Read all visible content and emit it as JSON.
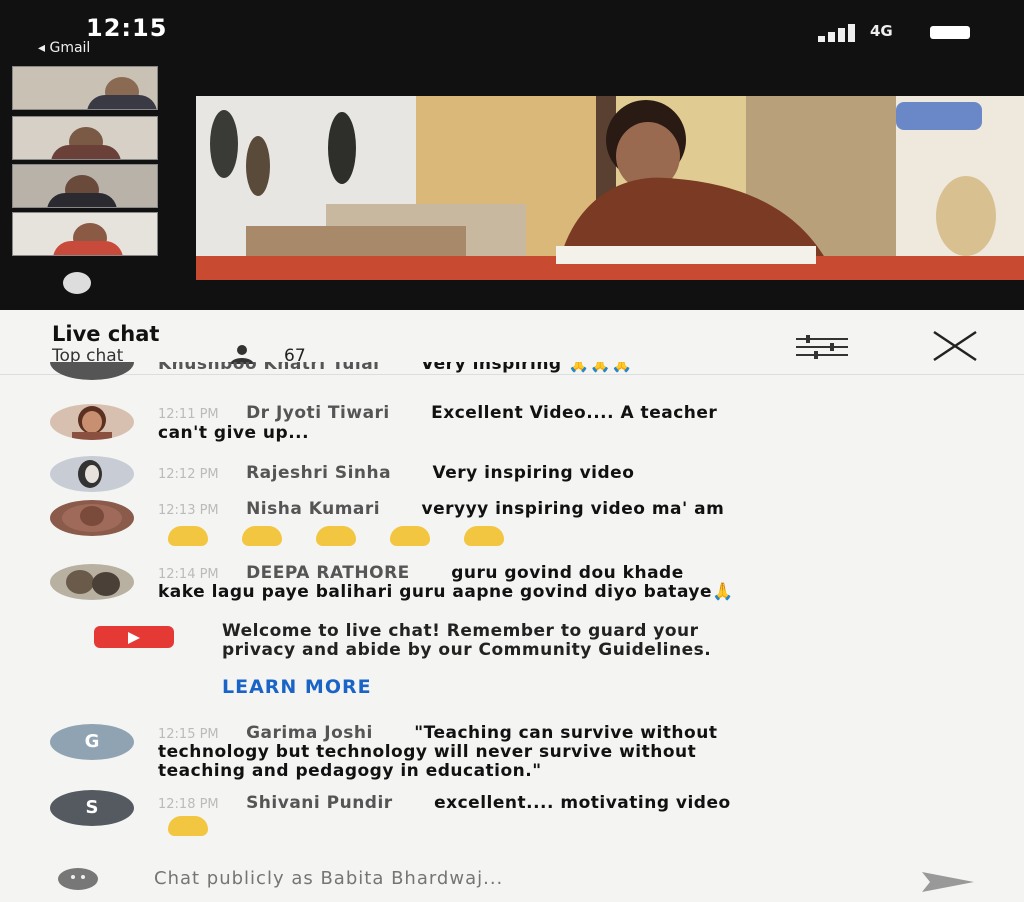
{
  "status_bar": {
    "time": "12:15",
    "back_app": "◂ Gmail",
    "network": "4G"
  },
  "chat": {
    "title": "Live chat",
    "filter_label": "Top chat",
    "viewer_count": "67",
    "partial_message": {
      "author": "Khushboo Khatri Tulai",
      "text": "Very inspiring 🙏🙏🙏"
    },
    "messages": [
      {
        "time": "12:11 PM",
        "author": "Dr Jyoti Tiwari",
        "text": "Excellent Video.... A teacher",
        "text_cont": "can't give up..."
      },
      {
        "time": "12:12 PM",
        "author": "Rajeshri Sinha",
        "text": "Very inspiring video"
      },
      {
        "time": "12:13 PM",
        "author": "Nisha Kumari",
        "text": "veryyy inspiring video ma' am",
        "emoji_count": 5
      },
      {
        "time": "12:14 PM",
        "author": "DEEPA RATHORE",
        "text": "guru govind dou khade",
        "text_cont": "kake lagu paye balihari guru aapne govind diyo bataye🙏"
      },
      {
        "time": "12:15 PM",
        "author": "Garima Joshi",
        "text": "\"Teaching can survive without",
        "text_cont": "technology but technology will never survive without",
        "text_cont2": "teaching and pedagogy in education.\"",
        "avatar_letter": "G",
        "avatar_color": "#8fa3b3"
      },
      {
        "time": "12:18 PM",
        "author": "Shivani Pundir",
        "text": "excellent.... motivating video",
        "emoji_count": 1,
        "avatar_letter": "S",
        "avatar_color": "#555a60"
      }
    ],
    "welcome": {
      "text": "Welcome to live chat! Remember to guard your",
      "text_cont": "privacy and abide by our Community Guidelines.",
      "learn_more": "LEARN MORE"
    },
    "input_placeholder": "Chat publicly as Babita Bhardwaj..."
  },
  "colors": {
    "accent_link": "#1a64c8",
    "youtube_red": "#e53935",
    "clap_yellow": "#f2c640"
  },
  "icons": [
    "signal-icon",
    "battery-icon",
    "mute-icon",
    "viewers-icon",
    "filter-icon",
    "close-icon",
    "youtube-icon",
    "emoji-icon",
    "send-icon"
  ]
}
